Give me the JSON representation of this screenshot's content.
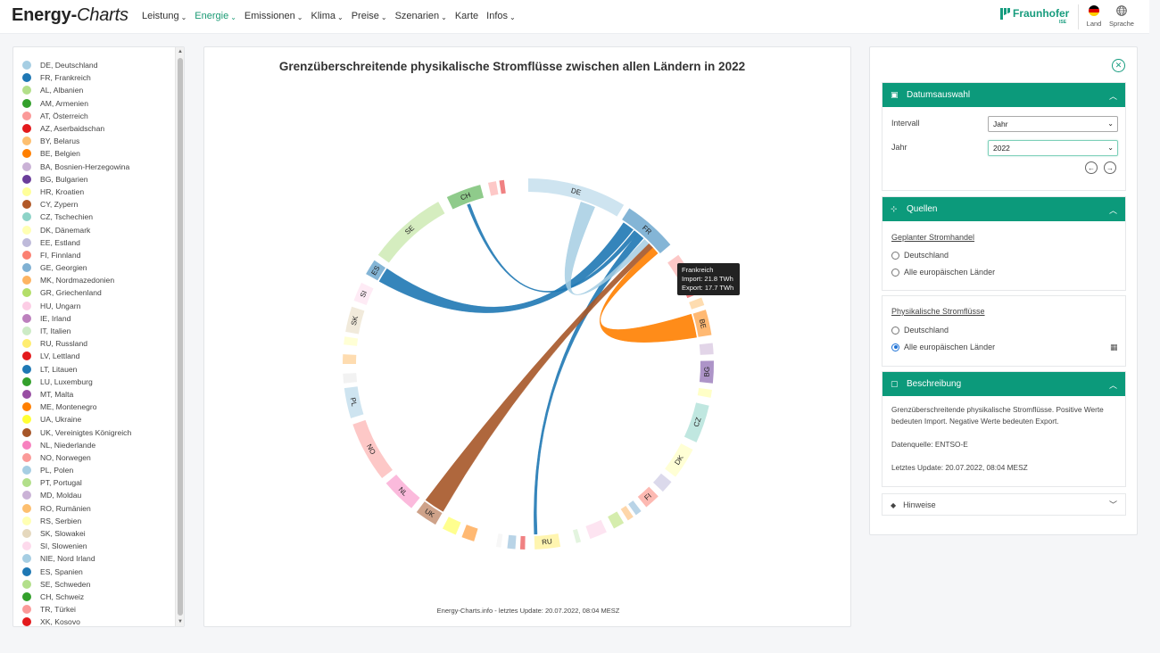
{
  "header": {
    "logo_a": "Energy-",
    "logo_b": "Charts",
    "nav": [
      {
        "label": "Leistung",
        "active": false
      },
      {
        "label": "Energie",
        "active": true
      },
      {
        "label": "Emissionen",
        "active": false
      },
      {
        "label": "Klima",
        "active": false
      },
      {
        "label": "Preise",
        "active": false
      },
      {
        "label": "Szenarien",
        "active": false
      },
      {
        "label": "Karte",
        "active": false,
        "nochevron": true
      },
      {
        "label": "Infos",
        "active": false
      }
    ],
    "fraunhofer": "Fraunhofer",
    "fraunhofer_sub": "ISE",
    "land_label": "Land",
    "sprache_label": "Sprache",
    "accent": "#169c7f"
  },
  "legend": [
    {
      "label": "DE, Deutschland",
      "color": "#a6cee3"
    },
    {
      "label": "FR, Frankreich",
      "color": "#1f78b4"
    },
    {
      "label": "AL, Albanien",
      "color": "#b2df8a"
    },
    {
      "label": "AM, Armenien",
      "color": "#33a02c"
    },
    {
      "label": "AT, Österreich",
      "color": "#fb9a99"
    },
    {
      "label": "AZ, Aserbaidschan",
      "color": "#e31a1c"
    },
    {
      "label": "BY, Belarus",
      "color": "#fdbf6f"
    },
    {
      "label": "BE, Belgien",
      "color": "#ff7f00"
    },
    {
      "label": "BA, Bosnien-Herzegowina",
      "color": "#cab2d6"
    },
    {
      "label": "BG, Bulgarien",
      "color": "#6a3d9a"
    },
    {
      "label": "HR, Kroatien",
      "color": "#ffff99"
    },
    {
      "label": "CY, Zypern",
      "color": "#b15928"
    },
    {
      "label": "CZ, Tschechien",
      "color": "#8dd3c7"
    },
    {
      "label": "DK, Dänemark",
      "color": "#ffffb3"
    },
    {
      "label": "EE, Estland",
      "color": "#bebada"
    },
    {
      "label": "FI, Finnland",
      "color": "#fb8072"
    },
    {
      "label": "GE, Georgien",
      "color": "#80b1d3"
    },
    {
      "label": "MK, Nordmazedonien",
      "color": "#fdb462"
    },
    {
      "label": "GR, Griechenland",
      "color": "#b3de69"
    },
    {
      "label": "HU, Ungarn",
      "color": "#fccde5"
    },
    {
      "label": "IE, Irland",
      "color": "#bc80bd"
    },
    {
      "label": "IT, Italien",
      "color": "#ccebc5"
    },
    {
      "label": "RU, Russland",
      "color": "#ffed6f"
    },
    {
      "label": "LV, Lettland",
      "color": "#e31a1c"
    },
    {
      "label": "LT, Litauen",
      "color": "#1f78b4"
    },
    {
      "label": "LU, Luxemburg",
      "color": "#33a02c"
    },
    {
      "label": "MT, Malta",
      "color": "#984ea3"
    },
    {
      "label": "ME, Montenegro",
      "color": "#ff7f00"
    },
    {
      "label": "UA, Ukraine",
      "color": "#ffff33"
    },
    {
      "label": "UK, Vereinigtes Königreich",
      "color": "#a65628"
    },
    {
      "label": "NL, Niederlande",
      "color": "#f781bf"
    },
    {
      "label": "NO, Norwegen",
      "color": "#fb9a99"
    },
    {
      "label": "PL, Polen",
      "color": "#a6cee3"
    },
    {
      "label": "PT, Portugal",
      "color": "#b2df8a"
    },
    {
      "label": "MD, Moldau",
      "color": "#cab2d6"
    },
    {
      "label": "RO, Rumänien",
      "color": "#fdbf6f"
    },
    {
      "label": "RS, Serbien",
      "color": "#ffffb3"
    },
    {
      "label": "SK, Slowakei",
      "color": "#e5d8bd"
    },
    {
      "label": "SI, Slowenien",
      "color": "#fddaec"
    },
    {
      "label": "NIE, Nord Irland",
      "color": "#a6cee3"
    },
    {
      "label": "ES, Spanien",
      "color": "#1f78b4"
    },
    {
      "label": "SE, Schweden",
      "color": "#b2df8a"
    },
    {
      "label": "CH, Schweiz",
      "color": "#33a02c"
    },
    {
      "label": "TR, Türkei",
      "color": "#fb9a99"
    },
    {
      "label": "XK, Kosovo",
      "color": "#e31a1c"
    }
  ],
  "chart": {
    "title": "Grenzüberschreitende physikalische Stromflüsse zwischen allen Ländern in 2022",
    "footer": "Energy-Charts.info - letztes Update: 20.07.2022, 08:04 MESZ",
    "tooltip": {
      "country": "Frankreich",
      "import": "Import: 21.8 TWh",
      "export": "Export: 17.7 TWh"
    }
  },
  "chart_data": {
    "type": "chord",
    "title": "Grenzüberschreitende physikalische Stromflüsse zwischen allen Ländern in 2022",
    "arcs": [
      {
        "label": "DE",
        "color": "#a6cee3",
        "start": 0,
        "end": 31
      },
      {
        "label": "FR",
        "color": "#1f78b4",
        "start": 33,
        "end": 50
      },
      {
        "label": "AT",
        "color": "#fb9a99",
        "start": 54,
        "end": 64
      },
      {
        "label": "",
        "color": "#e31a1c",
        "start": 66,
        "end": 67.5
      },
      {
        "label": "",
        "color": "#fdbf6f",
        "start": 69,
        "end": 71.5
      },
      {
        "label": "BE",
        "color": "#ff7f00",
        "start": 73,
        "end": 81
      },
      {
        "label": "",
        "color": "#cab2d6",
        "start": 83.5,
        "end": 87
      },
      {
        "label": "BG",
        "color": "#6a3d9a",
        "start": 89,
        "end": 96
      },
      {
        "label": "",
        "color": "#ffff99",
        "start": 98,
        "end": 100.5
      },
      {
        "label": "CZ",
        "color": "#8dd3c7",
        "start": 103,
        "end": 115
      },
      {
        "label": "DK",
        "color": "#ffffb3",
        "start": 117.5,
        "end": 127.5
      },
      {
        "label": "",
        "color": "#bebada",
        "start": 129.5,
        "end": 133.5
      },
      {
        "label": "FI",
        "color": "#fb8072",
        "start": 135.5,
        "end": 140.5
      },
      {
        "label": "",
        "color": "#80b1d3",
        "start": 142.5,
        "end": 144.5
      },
      {
        "label": "",
        "color": "#fdb462",
        "start": 145.5,
        "end": 147.5
      },
      {
        "label": "",
        "color": "#b3de69",
        "start": 149,
        "end": 152.5
      },
      {
        "label": "",
        "color": "#fccde5",
        "start": 155,
        "end": 160.5
      },
      {
        "label": "",
        "color": "#ccebc5",
        "start": 163.5,
        "end": 165
      },
      {
        "label": "RU",
        "color": "#ffed6f",
        "start": 170,
        "end": 178
      },
      {
        "label": "",
        "color": "#e31a1c",
        "start": 181,
        "end": 182.5
      },
      {
        "label": "",
        "color": "#80b1d3",
        "start": 184,
        "end": 186.5
      },
      {
        "label": "",
        "color": "#f0f0f0",
        "start": 188.5,
        "end": 190
      },
      {
        "label": "",
        "color": "#ff7f00",
        "start": 197,
        "end": 201
      },
      {
        "label": "",
        "color": "#ffff33",
        "start": 203,
        "end": 207.5
      },
      {
        "label": "UK",
        "color": "#a65628",
        "start": 210,
        "end": 217
      },
      {
        "label": "NL",
        "color": "#f781bf",
        "start": 219,
        "end": 230
      },
      {
        "label": "NO",
        "color": "#fb9a99",
        "start": 232,
        "end": 251
      },
      {
        "label": "PL",
        "color": "#a6cee3",
        "start": 253,
        "end": 262.5
      },
      {
        "label": "",
        "color": "#e8e8e8",
        "start": 264,
        "end": 267
      },
      {
        "label": "",
        "color": "#fdbf6f",
        "start": 270,
        "end": 273
      },
      {
        "label": "",
        "color": "#ffffb3",
        "start": 276,
        "end": 278.5
      },
      {
        "label": "SK",
        "color": "#e5d8bd",
        "start": 280,
        "end": 288
      },
      {
        "label": "SI",
        "color": "#fddaec",
        "start": 290,
        "end": 296
      },
      {
        "label": "ES",
        "color": "#1f78b4",
        "start": 299,
        "end": 304
      },
      {
        "label": "SE",
        "color": "#b2df8a",
        "start": 306,
        "end": 331
      },
      {
        "label": "CH",
        "color": "#33a02c",
        "start": 334,
        "end": 345
      },
      {
        "label": "",
        "color": "#fb9a99",
        "start": 347.5,
        "end": 350
      },
      {
        "label": "",
        "color": "#e31a1c",
        "start": 351,
        "end": 352.5
      }
    ],
    "ribbons": [
      {
        "from": "FR",
        "to": "ES",
        "color": "#1f78b4",
        "a": [
          34,
          38
        ],
        "b": [
          299,
          304
        ]
      },
      {
        "from": "FR",
        "to": "CH",
        "color": "#1f78b4",
        "a": [
          38.5,
          40
        ],
        "b": [
          339,
          340
        ]
      },
      {
        "from": "FR",
        "to": "RU",
        "color": "#1f78b4",
        "a": [
          40,
          42.5
        ],
        "b": [
          177,
          178
        ]
      },
      {
        "from": "FR",
        "to": "UK",
        "color": "#a65628",
        "a": [
          45,
          47
        ],
        "b": [
          210,
          217
        ]
      },
      {
        "from": "FR",
        "to": "BE",
        "color": "#ff7f00",
        "a": [
          47,
          49.5
        ],
        "b": [
          73,
          81
        ]
      },
      {
        "from": "DE",
        "to": "FR",
        "color": "#a6cee3",
        "a": [
          18,
          23
        ],
        "b": [
          43,
          45
        ]
      }
    ]
  },
  "controls": {
    "datum": {
      "title": "Datumsauswahl",
      "interval_label": "Intervall",
      "interval_value": "Jahr",
      "year_label": "Jahr",
      "year_value": "2022"
    },
    "quellen": {
      "title": "Quellen",
      "geplant_title": "Geplanter Stromhandel",
      "geplant_options": [
        {
          "label": "Deutschland",
          "checked": false
        },
        {
          "label": "Alle europäischen Länder",
          "checked": false
        }
      ],
      "phys_title": "Physikalische Stromflüsse",
      "phys_options": [
        {
          "label": "Deutschland",
          "checked": false
        },
        {
          "label": "Alle europäischen Länder",
          "checked": true
        }
      ]
    },
    "beschreibung": {
      "title": "Beschreibung",
      "text": "Grenzüberschreitende physikalische Stromflüsse. Positive Werte bedeuten Import. Negative Werte bedeuten Export.",
      "source": "Datenquelle: ENTSO-E",
      "update": "Letztes Update:  20.07.2022, 08:04 MESZ"
    },
    "hinweise": {
      "title": "Hinweise"
    }
  }
}
